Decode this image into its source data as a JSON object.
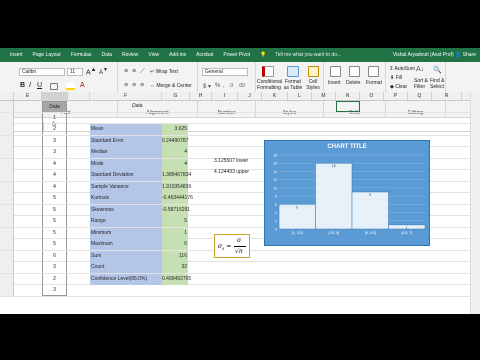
{
  "tabs": [
    "Insert",
    "Page Layout",
    "Formulas",
    "Data",
    "Review",
    "View",
    "Add-ins",
    "Acrobat",
    "Power Pivot"
  ],
  "tell_me": "Tell me what you want to do...",
  "user": "Vishal Aryadouti (Asst Prof)",
  "share": "Share",
  "ribbon": {
    "font_name": "Calibri",
    "font_size": "11",
    "wrap_text": "Wrap Text",
    "merge_center": "Merge & Center",
    "number_format": "General",
    "conditional_formatting": "Conditional Formatting",
    "format_as_table": "Format as Table",
    "cell_styles": "Cell Styles",
    "insert": "Insert",
    "delete": "Delete",
    "format": "Format",
    "autosum": "AutoSum",
    "fill": "Fill",
    "clear": "Clear",
    "sort_filter": "Sort & Filter",
    "find_select": "Find & Select",
    "groups": {
      "font": "Font",
      "alignment": "Alignment",
      "number": "Number",
      "styles": "Styles",
      "cells": "Cells",
      "editing": "Editing"
    },
    "inter": "inter"
  },
  "columns": [
    "E",
    "F",
    "G",
    "H",
    "I",
    "J",
    "K",
    "L",
    "M",
    "N",
    "O",
    "P",
    "Q",
    "R"
  ],
  "header_a": "Data",
  "header_f": "Data",
  "data_values": [
    "1",
    "2",
    "3",
    "3",
    "4",
    "4",
    "4",
    "5",
    "5",
    "5",
    "5",
    "5",
    "6",
    "3",
    "2",
    "3"
  ],
  "stats": [
    {
      "label": "Mean",
      "value": "3.625"
    },
    {
      "label": "Standard Error",
      "value": "0.24490787"
    },
    {
      "label": "Median",
      "value": "4"
    },
    {
      "label": "Mode",
      "value": "4"
    },
    {
      "label": "Standard Deviation",
      "value": "1.385467834"
    },
    {
      "label": "Sample Variance",
      "value": "1.919354839"
    },
    {
      "label": "Kurtosis",
      "value": "-0.453444176"
    },
    {
      "label": "Skewness",
      "value": "-0.58715291"
    },
    {
      "label": "Range",
      "value": "5"
    },
    {
      "label": "Minimum",
      "value": "1"
    },
    {
      "label": "Maximum",
      "value": "6"
    },
    {
      "label": "Sum",
      "value": "116"
    },
    {
      "label": "Count",
      "value": "32"
    },
    {
      "label": "Confidence Level(95.0%)",
      "value": "0.499492765"
    }
  ],
  "bounds": [
    {
      "value": "3.125507",
      "label": "lower"
    },
    {
      "value": "4.124493",
      "label": "upper"
    }
  ],
  "formula": {
    "lhs": "σ",
    "sub": "x̄",
    "num": "σ",
    "den": "√n"
  },
  "chart_data": {
    "type": "bar",
    "title": "CHART TITLE",
    "categories": [
      "[1, 3.5]",
      "(3.5, 6]",
      "(6, 8.5]",
      "(8.5, 7]"
    ],
    "values": [
      6,
      16,
      9,
      1
    ],
    "ylim": [
      0,
      18
    ],
    "yticks": [
      "0",
      "2",
      "4",
      "6",
      "8",
      "10",
      "12",
      "14",
      "16",
      "18"
    ],
    "grid": true,
    "colors": {
      "background": "#5b9bd5",
      "bar": "#ffffff"
    }
  }
}
